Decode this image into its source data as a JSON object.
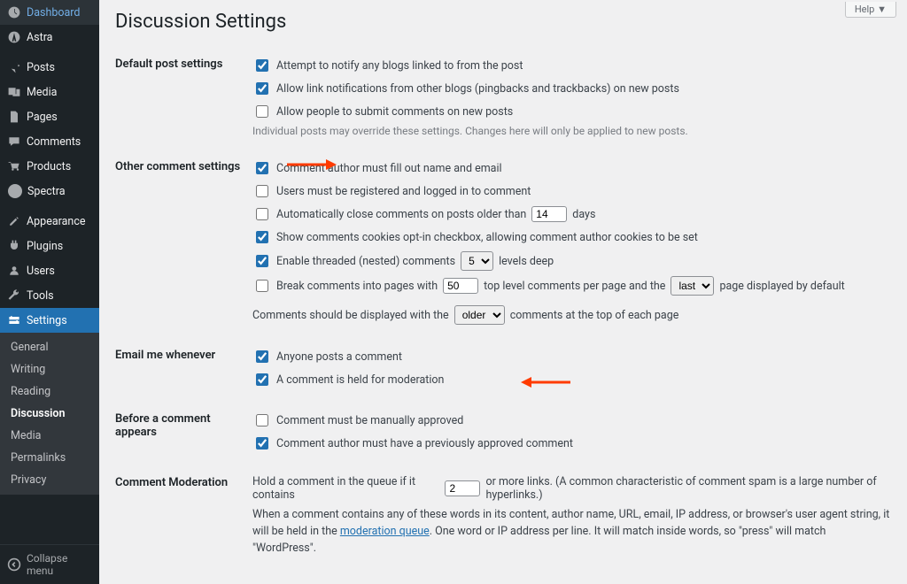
{
  "sidebar": {
    "items": [
      {
        "label": "Dashboard"
      },
      {
        "label": "Astra"
      },
      {
        "label": "Posts"
      },
      {
        "label": "Media"
      },
      {
        "label": "Pages"
      },
      {
        "label": "Comments"
      },
      {
        "label": "Products"
      },
      {
        "label": "Spectra"
      },
      {
        "label": "Appearance"
      },
      {
        "label": "Plugins"
      },
      {
        "label": "Users"
      },
      {
        "label": "Tools"
      },
      {
        "label": "Settings"
      }
    ],
    "sub": [
      "General",
      "Writing",
      "Reading",
      "Discussion",
      "Media",
      "Permalinks",
      "Privacy"
    ],
    "collapse": "Collapse menu"
  },
  "help_tab": "Help",
  "page_title": "Discussion Settings",
  "sections": {
    "default": {
      "heading": "Default post settings",
      "opt1": "Attempt to notify any blogs linked to from the post",
      "opt2": "Allow link notifications from other blogs (pingbacks and trackbacks) on new posts",
      "opt3": "Allow people to submit comments on new posts",
      "desc": "Individual posts may override these settings. Changes here will only be applied to new posts."
    },
    "other": {
      "heading": "Other comment settings",
      "opt1": "Comment author must fill out name and email",
      "opt2": "Users must be registered and logged in to comment",
      "opt3a": "Automatically close comments on posts older than",
      "opt3_val": "14",
      "opt3b": "days",
      "opt4": "Show comments cookies opt-in checkbox, allowing comment author cookies to be set",
      "opt5a": "Enable threaded (nested) comments",
      "opt5_val": "5",
      "opt5b": "levels deep",
      "opt6a": "Break comments into pages with",
      "opt6_val": "50",
      "opt6b": "top level comments per page and the",
      "opt6_sel": "last",
      "opt6c": "page displayed by default",
      "opt7a": "Comments should be displayed with the",
      "opt7_sel": "older",
      "opt7b": "comments at the top of each page"
    },
    "email": {
      "heading": "Email me whenever",
      "opt1": "Anyone posts a comment",
      "opt2": "A comment is held for moderation"
    },
    "before": {
      "heading": "Before a comment appears",
      "opt1": "Comment must be manually approved",
      "opt2": "Comment author must have a previously approved comment"
    },
    "moderation": {
      "heading": "Comment Moderation",
      "line1a": "Hold a comment in the queue if it contains",
      "line1_val": "2",
      "line1b": "or more links. (A common characteristic of comment spam is a large number of hyperlinks.)",
      "line2a": "When a comment contains any of these words in its content, author name, URL, email, IP address, or browser's user agent string, it will be held in the ",
      "line2_link": "moderation queue",
      "line2b": ". One word or IP address per line. It will match inside words, so \"press\" will match \"WordPress\"."
    }
  }
}
